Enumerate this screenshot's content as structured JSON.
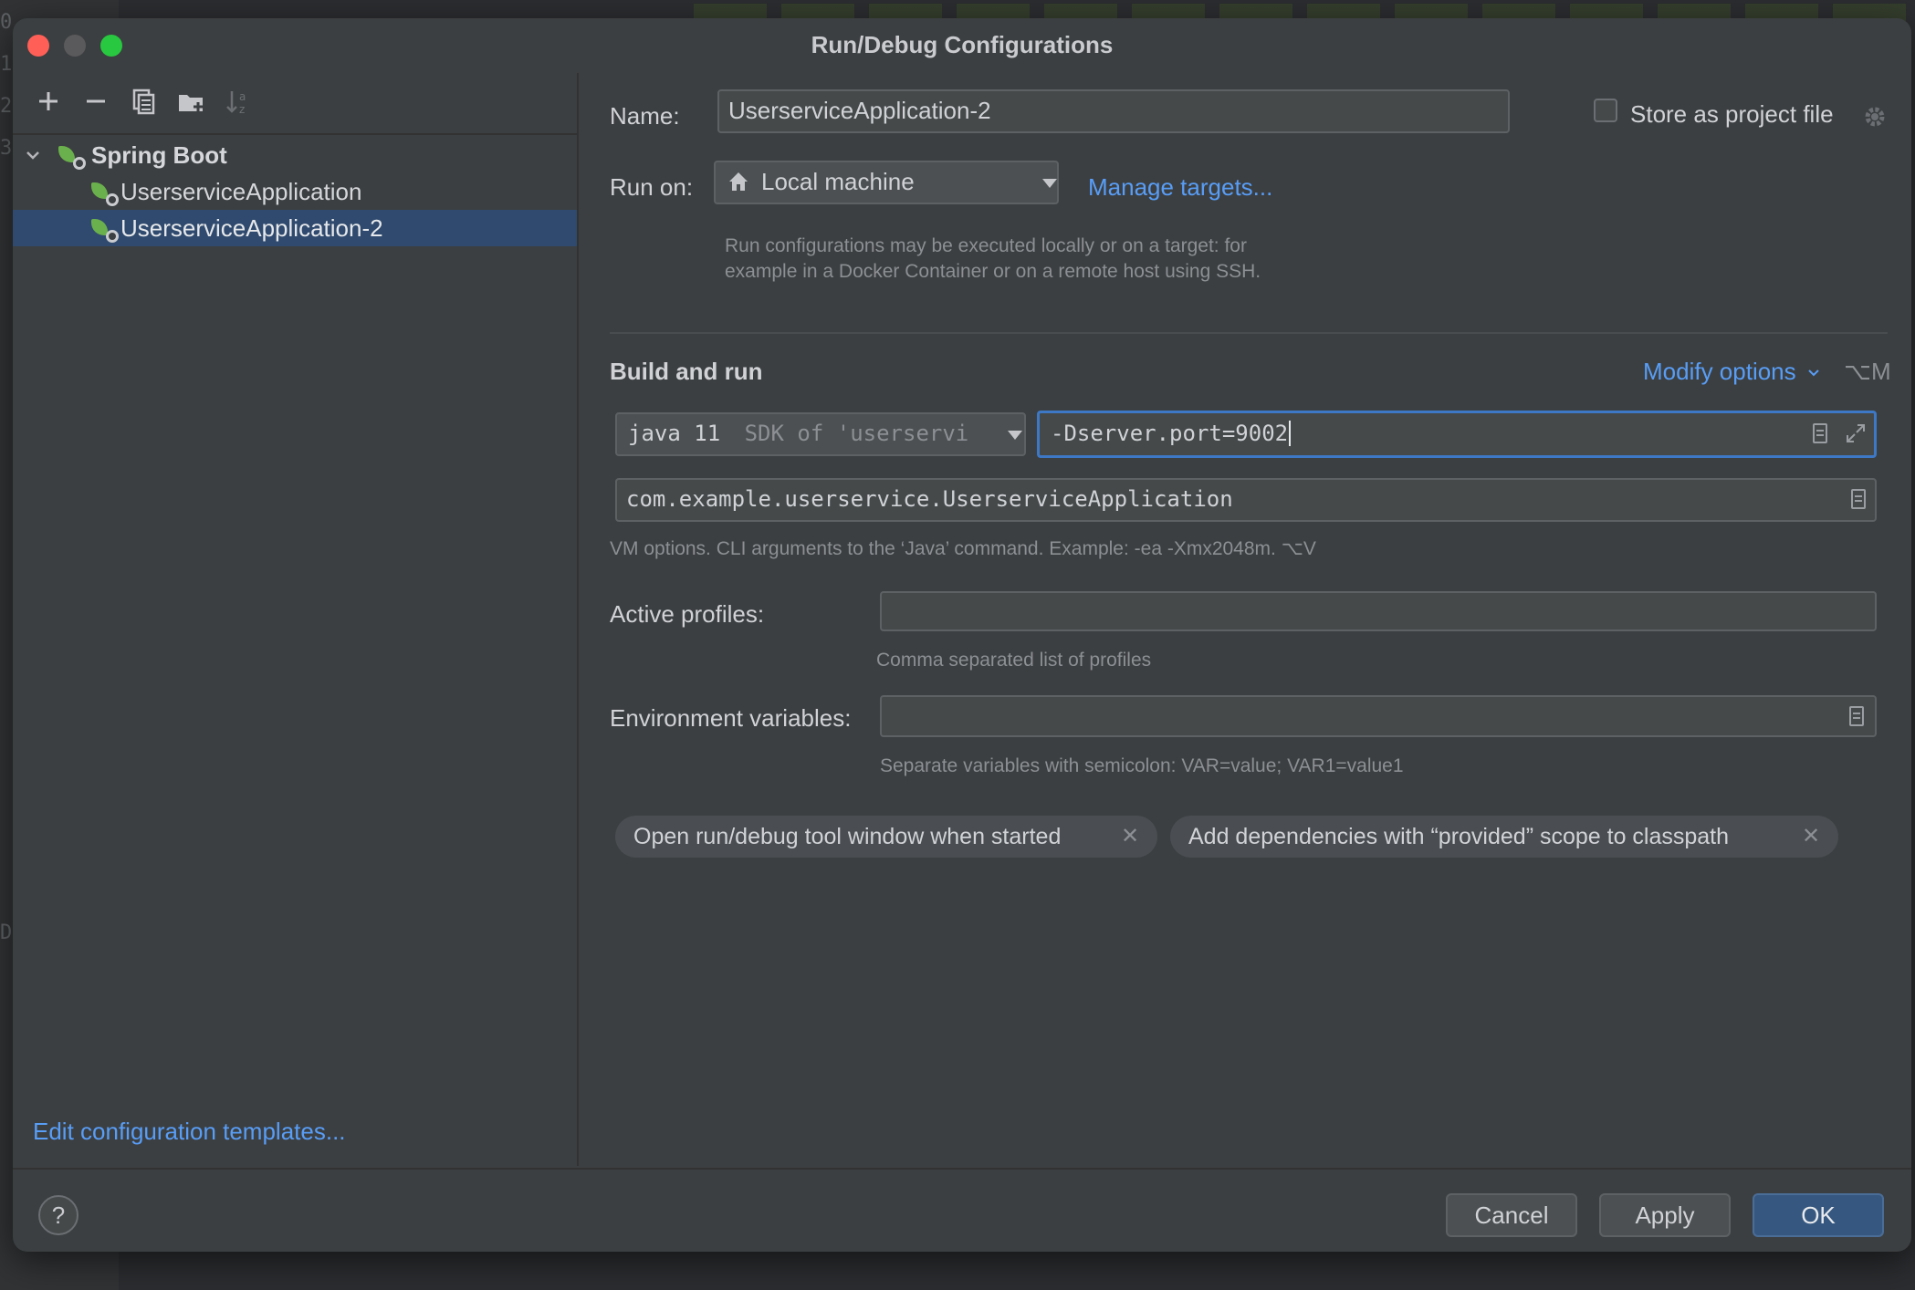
{
  "dialog": {
    "title": "Run/Debug Configurations"
  },
  "background": {
    "line_numbers": [
      "0",
      "1",
      "2",
      "3",
      "D"
    ]
  },
  "sidebar": {
    "toolbar_icons": [
      "add-icon",
      "remove-icon",
      "copy-icon",
      "folder-add-icon",
      "sort-icon"
    ],
    "group": {
      "label": "Spring Boot",
      "icon": "spring-boot-icon",
      "expanded": true
    },
    "items": [
      {
        "label": "UserserviceApplication",
        "selected": false
      },
      {
        "label": "UserserviceApplication-2",
        "selected": true
      }
    ],
    "edit_templates_link": "Edit configuration templates..."
  },
  "form": {
    "name_label": "Name:",
    "name_value": "UserserviceApplication-2",
    "store_as_project_file_label": "Store as project file",
    "store_as_project_file_checked": false,
    "run_on_label": "Run on:",
    "run_on_value": "Local machine",
    "manage_targets_link": "Manage targets...",
    "run_on_hint_line1": "Run configurations may be executed locally or on a target: for",
    "run_on_hint_line2": "example in a Docker Container or on a remote host using SSH.",
    "build_and_run_title": "Build and run",
    "modify_options_link": "Modify options",
    "modify_options_shortcut": "⌥M",
    "sdk_main": "java 11",
    "sdk_detail": "SDK of 'userservi",
    "vm_options_value": "-Dserver.port=9002",
    "main_class_value": "com.example.userservice.UserserviceApplication",
    "vm_options_hint": "VM options. CLI arguments to the ‘Java’ command. Example: -ea -Xmx2048m. ⌥V",
    "active_profiles_label": "Active profiles:",
    "active_profiles_value": "",
    "active_profiles_hint": "Comma separated list of profiles",
    "env_vars_label": "Environment variables:",
    "env_vars_value": "",
    "env_vars_hint": "Separate variables with semicolon: VAR=value; VAR1=value1",
    "chips": [
      "Open run/debug tool window when started",
      "Add dependencies with “provided” scope to classpath"
    ]
  },
  "footer": {
    "help_label": "?",
    "cancel_label": "Cancel",
    "apply_label": "Apply",
    "ok_label": "OK"
  },
  "colors": {
    "dialog_bg": "#3c3f41",
    "accent_link": "#589df6",
    "selection": "#2f4a6e",
    "primary_button": "#365880",
    "focus_border": "#3d78c6"
  }
}
